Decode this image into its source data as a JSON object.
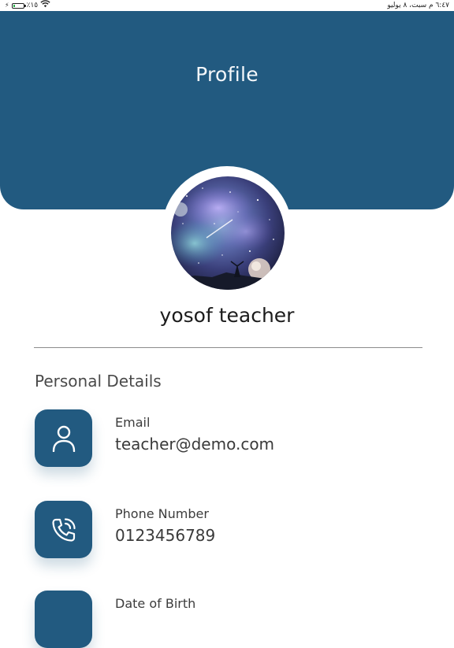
{
  "status_bar": {
    "battery_text": "٪١٥",
    "battery_level": 0.15,
    "battery_color": "#28b34a",
    "time_date": "٦:٤٧ م  سبت، ٨ يوليو",
    "icons": [
      "charging-icon",
      "battery-icon",
      "wifi-icon"
    ]
  },
  "header": {
    "title": "Profile",
    "background_color": "#225a80"
  },
  "profile": {
    "name": "yosof teacher",
    "avatar_description_icon": "avatar"
  },
  "personal_details": {
    "section_title": "Personal Details",
    "items": [
      {
        "label": "Email",
        "value": "teacher@demo.com",
        "icon": "person-icon"
      },
      {
        "label": "Phone Number",
        "value": "0123456789",
        "icon": "phone-icon"
      },
      {
        "label": "Date of Birth",
        "value": "",
        "icon": "calendar-icon"
      }
    ]
  },
  "colors": {
    "accent": "#225a80",
    "text_primary": "#1b1b1b",
    "text_secondary": "#3c3c3c"
  }
}
